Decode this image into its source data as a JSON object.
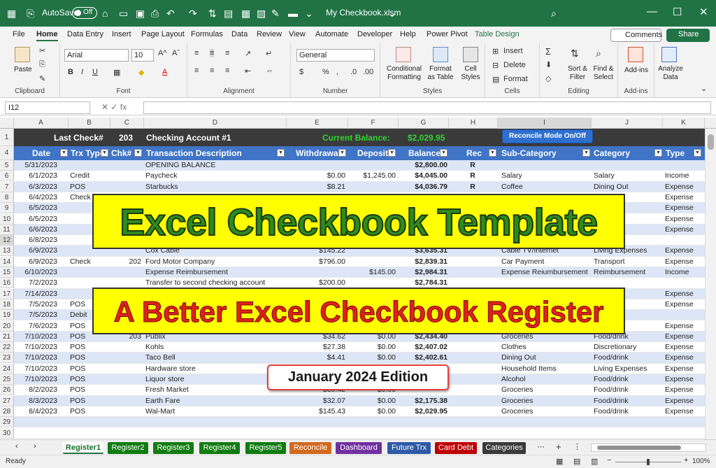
{
  "titlebar": {
    "autosave": "AutoSave",
    "toggle": "Off",
    "filename": "My Checkbook.xlsm"
  },
  "menu": [
    "File",
    "Home",
    "Data Entry",
    "Insert",
    "Page Layout",
    "Formulas",
    "Data",
    "Review",
    "View",
    "Automate",
    "Developer",
    "Help",
    "Power Pivot",
    "Table Design"
  ],
  "comments": "Comments",
  "share": "Share",
  "ribbon": {
    "clipboard": {
      "name": "Clipboard",
      "paste": "Paste"
    },
    "font": {
      "name": "Font",
      "family": "Arial",
      "size": "10"
    },
    "alignment": {
      "name": "Alignment"
    },
    "number": {
      "name": "Number",
      "format": "General"
    },
    "styles": {
      "name": "Styles",
      "cond": "Conditional Formatting",
      "fmt_table": "Format as Table",
      "cell_styles": "Cell Styles"
    },
    "cells": {
      "name": "Cells",
      "insert": "Insert",
      "delete": "Delete",
      "format": "Format"
    },
    "editing": {
      "name": "Editing",
      "sort": "Sort & Filter",
      "find": "Find & Select"
    },
    "addins": {
      "name": "Add-ins",
      "label": "Add-ins"
    },
    "analyze": {
      "label": "Analyze Data"
    }
  },
  "namebox": "I12",
  "columns": [
    "A",
    "B",
    "C",
    "D",
    "E",
    "F",
    "G",
    "H",
    "I",
    "J",
    "K"
  ],
  "rownums": [
    "1",
    "4",
    "5",
    "6",
    "7",
    "8",
    "9",
    "10",
    "11",
    "12",
    "13",
    "14",
    "15",
    "16",
    "17",
    "18",
    "19",
    "20",
    "21",
    "22",
    "23",
    "24",
    "25",
    "26",
    "27",
    "28",
    "29",
    "30"
  ],
  "header_row": {
    "last_check_label": "Last Check#",
    "last_check": "203",
    "account": "Checking Account #1",
    "balance_label": "Current Balance:",
    "balance": "$2,029.95",
    "reconcile_btn": "Reconcile Mode On/Off"
  },
  "table_headers": [
    "Date",
    "Trx Type",
    "Chk#",
    "Transaction Description",
    "Withdrawal",
    "Deposit",
    "Balance",
    "Rec",
    "Sub-Category",
    "Category",
    "Type"
  ],
  "rows": [
    [
      "5/31/2023",
      "",
      "",
      "OPENING BALANCE",
      "",
      "",
      "$2,800.00",
      "R",
      "",
      "",
      ""
    ],
    [
      "6/1/2023",
      "Credit",
      "",
      "Paycheck",
      "$0.00",
      "$1,245.00",
      "$4,045.00",
      "R",
      "Salary",
      "Salary",
      "Income"
    ],
    [
      "6/3/2023",
      "POS",
      "",
      "Starbucks",
      "$8.21",
      "",
      "$4,036.79",
      "R",
      "Coffee",
      "Dining Out",
      "Expense"
    ],
    [
      "6/4/2023",
      "Check",
      "",
      "",
      "",
      "",
      "",
      "",
      "",
      "enses",
      "Expense"
    ],
    [
      "6/5/2023",
      "",
      "",
      "",
      "",
      "",
      "",
      "",
      "",
      "",
      "Expense"
    ],
    [
      "6/5/2023",
      "",
      "",
      "",
      "",
      "",
      "",
      "",
      "",
      "",
      "Expense"
    ],
    [
      "6/6/2023",
      "",
      "",
      "",
      "",
      "",
      "",
      "",
      "",
      "enses",
      "Expense"
    ],
    [
      "6/8/2023",
      "",
      "",
      "",
      "",
      "",
      "",
      "",
      "",
      "",
      ""
    ],
    [
      "6/9/2023",
      "",
      "",
      "Cox Cable",
      "$145.22",
      "",
      "$3,635.31",
      "",
      "Cable TV/Internet",
      "Living Expenses",
      "Expense"
    ],
    [
      "6/9/2023",
      "Check",
      "202",
      "Ford Motor Company",
      "$796.00",
      "",
      "$2,839.31",
      "",
      "Car Payment",
      "Transport",
      "Expense"
    ],
    [
      "6/10/2023",
      "",
      "",
      "Expense Reimbursement",
      "",
      "$145.00",
      "$2,984.31",
      "",
      "Expense Reiumbursement",
      "Reimbursement",
      "Income"
    ],
    [
      "7/2/2023",
      "",
      "",
      "Transfer to second checking account",
      "$200.00",
      "",
      "$2,784.31",
      "",
      "",
      "",
      ""
    ],
    [
      "7/14/2023",
      "",
      "",
      "",
      "",
      "",
      "",
      "",
      "",
      "enses",
      "Expense"
    ],
    [
      "7/5/2023",
      "POS",
      "",
      "",
      "",
      "",
      "",
      "",
      "",
      "",
      "Expense"
    ],
    [
      "7/5/2023",
      "Debit",
      "",
      "",
      "",
      "",
      "",
      "",
      "",
      "",
      ""
    ],
    [
      "7/6/2023",
      "POS",
      "",
      "",
      "",
      "",
      "",
      "",
      "",
      "ary",
      "Expense"
    ],
    [
      "7/10/2023",
      "POS",
      "203",
      "Publix",
      "$34.62",
      "$0.00",
      "$2,434.40",
      "",
      "Groceries",
      "Food/drink",
      "Expense"
    ],
    [
      "7/10/2023",
      "POS",
      "",
      "Kohls",
      "$27.38",
      "$0.00",
      "$2,407.02",
      "",
      "Clothes",
      "Discretionary",
      "Expense"
    ],
    [
      "7/10/2023",
      "POS",
      "",
      "Taco Bell",
      "$4.41",
      "$0.00",
      "$2,402.61",
      "",
      "Dining Out",
      "Food/drink",
      "Expense"
    ],
    [
      "7/10/2023",
      "POS",
      "",
      "Hardware store",
      "",
      "",
      "",
      "",
      "Household Items",
      "Living Expenses",
      "Expense"
    ],
    [
      "7/10/2023",
      "POS",
      "",
      "Liquor store",
      "",
      "",
      "",
      "",
      "Alcohol",
      "Food/drink",
      "Expense"
    ],
    [
      "8/2/2023",
      "POS",
      "",
      "Fresh Market",
      "$30.42",
      "$0.00",
      "",
      "",
      "Groceries",
      "Food/drink",
      "Expense"
    ],
    [
      "8/3/2023",
      "POS",
      "",
      "Earth Fare",
      "$32.07",
      "$0.00",
      "$2,175.38",
      "",
      "Groceries",
      "Food/drink",
      "Expense"
    ],
    [
      "8/4/2023",
      "POS",
      "",
      "Wal-Mart",
      "$145.43",
      "$0.00",
      "$2,029.95",
      "",
      "Groceries",
      "Food/drink",
      "Expense"
    ],
    [
      "",
      "",
      "",
      "",
      "",
      "",
      "",
      "",
      "",
      "",
      ""
    ],
    [
      "",
      "",
      "",
      "",
      "",
      "",
      "",
      "",
      "",
      "",
      ""
    ]
  ],
  "banner_title": "Excel Checkbook Template",
  "banner_sub": "A Better Excel Checkbook Register",
  "banner_edition": "January 2024 Edition",
  "sheets": [
    {
      "label": "Register1",
      "color": "#ffffff"
    },
    {
      "label": "Register2",
      "color": "#107c10"
    },
    {
      "label": "Register3",
      "color": "#107c10"
    },
    {
      "label": "Register4",
      "color": "#107c10"
    },
    {
      "label": "Register5",
      "color": "#107c10"
    },
    {
      "label": "Reconcile",
      "color": "#d2691e"
    },
    {
      "label": "Dashboard",
      "color": "#7030a0"
    },
    {
      "label": "Future Trx",
      "color": "#2e5aa8"
    },
    {
      "label": "Card Debt",
      "color": "#c00000"
    },
    {
      "label": "Categories",
      "color": "#3a3a3a"
    }
  ],
  "status": {
    "ready": "Ready",
    "zoom": "100%"
  },
  "colors": {
    "excel_green": "#217346",
    "table_header": "#3f74c6",
    "band": "#dde6f6",
    "banner_yellow": "#ffff00",
    "title_green": "#2e8b1e",
    "sub_red": "#e0201a",
    "balance_green": "#32d232"
  }
}
